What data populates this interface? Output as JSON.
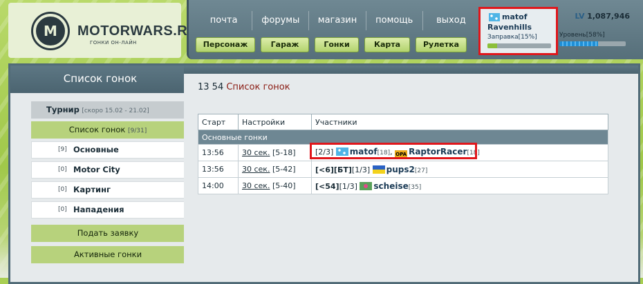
{
  "logo": {
    "title": "MOTORWARS.RU",
    "subtitle": "ГОНКИ ОН-ЛАЙН"
  },
  "top_nav": [
    "почта",
    "форумы",
    "магазин",
    "помощь",
    "выход"
  ],
  "main_buttons": [
    "Персонаж",
    "Гараж",
    "Гонки",
    "Карта",
    "Рулетка"
  ],
  "user": {
    "name": "matof",
    "city": "Ravenhills",
    "fuel_label": "Заправка[15%]",
    "fuel_percent": 15,
    "level_prefix": "LV",
    "level_value": "1,087,946",
    "level_label": "Уровень[58%]",
    "level_percent": 58
  },
  "sidebar": {
    "title": "Список гонок",
    "tournament": {
      "label": "Турнир",
      "note": "[скоро 15.02 - 21.02]"
    },
    "race_list": {
      "label": "Список гонок",
      "count": "[9/31]"
    },
    "categories": [
      {
        "count": "[9]",
        "label": "Основные"
      },
      {
        "count": "[0]",
        "label": "Motor City"
      },
      {
        "count": "[0]",
        "label": "Картинг"
      },
      {
        "count": "[0]",
        "label": "Нападения"
      }
    ],
    "apply": "Подать заявку",
    "active": "Активные гонки"
  },
  "main": {
    "title_time": "13 54",
    "title_text": "Список гонок",
    "columns": [
      "Старт",
      "Настройки",
      "Участники"
    ],
    "group": "Основные гонки",
    "rows": [
      {
        "start": "13:56",
        "setting_link": "30 сек.",
        "setting_range": "[5-18]",
        "prefix": "[2/3]",
        "players": [
          {
            "flag": "flag-blue",
            "name": "matof",
            "level": "[18]",
            "sep": ", "
          },
          {
            "flag": "flag-opa",
            "name": "RaptorRacer",
            "level": "[18]",
            "sep": ""
          }
        ]
      },
      {
        "start": "13:56",
        "setting_link": "30 сек.",
        "setting_range": "[5-42]",
        "prefix_bold": "[<6][БТ]",
        "prefix": "[1/3]",
        "players": [
          {
            "flag": "flag-ua",
            "name": "pups2",
            "level": "[27]",
            "sep": ""
          }
        ]
      },
      {
        "start": "14:00",
        "setting_link": "30 сек.",
        "setting_range": "[5-40]",
        "prefix_bold": "[<54]",
        "prefix": "[1/3]",
        "players": [
          {
            "flag": "flag-pink",
            "name": "scheise",
            "level": "[35]",
            "sep": ""
          }
        ]
      }
    ]
  },
  "colors": {
    "highlight": "#e0161b",
    "panel": "#516b77",
    "green": "#b7d27c"
  }
}
